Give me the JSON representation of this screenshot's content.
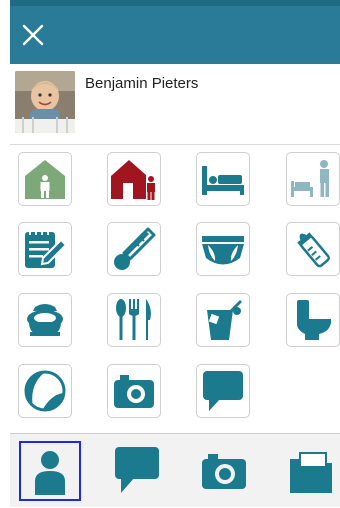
{
  "header": {
    "close_icon": "close-icon",
    "color": "#2a7b98"
  },
  "profile": {
    "name": "Benjamin Pieters"
  },
  "grid": {
    "icons": [
      "home-icon",
      "parent-at-home-icon",
      "bed-icon",
      "bedside-icon",
      "diary-icon",
      "thermometer-icon",
      "diaper-icon",
      "baby-bottle-icon",
      "potty-icon",
      "cutlery-icon",
      "drink-icon",
      "toilet-icon",
      "ball-icon",
      "camera-icon",
      "message-icon"
    ],
    "primary_color": "#1c7a8f",
    "accent_red": "#a1151e",
    "accent_green": "#7da87a",
    "muted_color": "#8fb6c3"
  },
  "tabbar": {
    "tabs": [
      "person-icon",
      "chat-icon",
      "camera-icon",
      "folder-icon"
    ],
    "selected": "person-icon",
    "selected_border": "#1d2bd8"
  }
}
